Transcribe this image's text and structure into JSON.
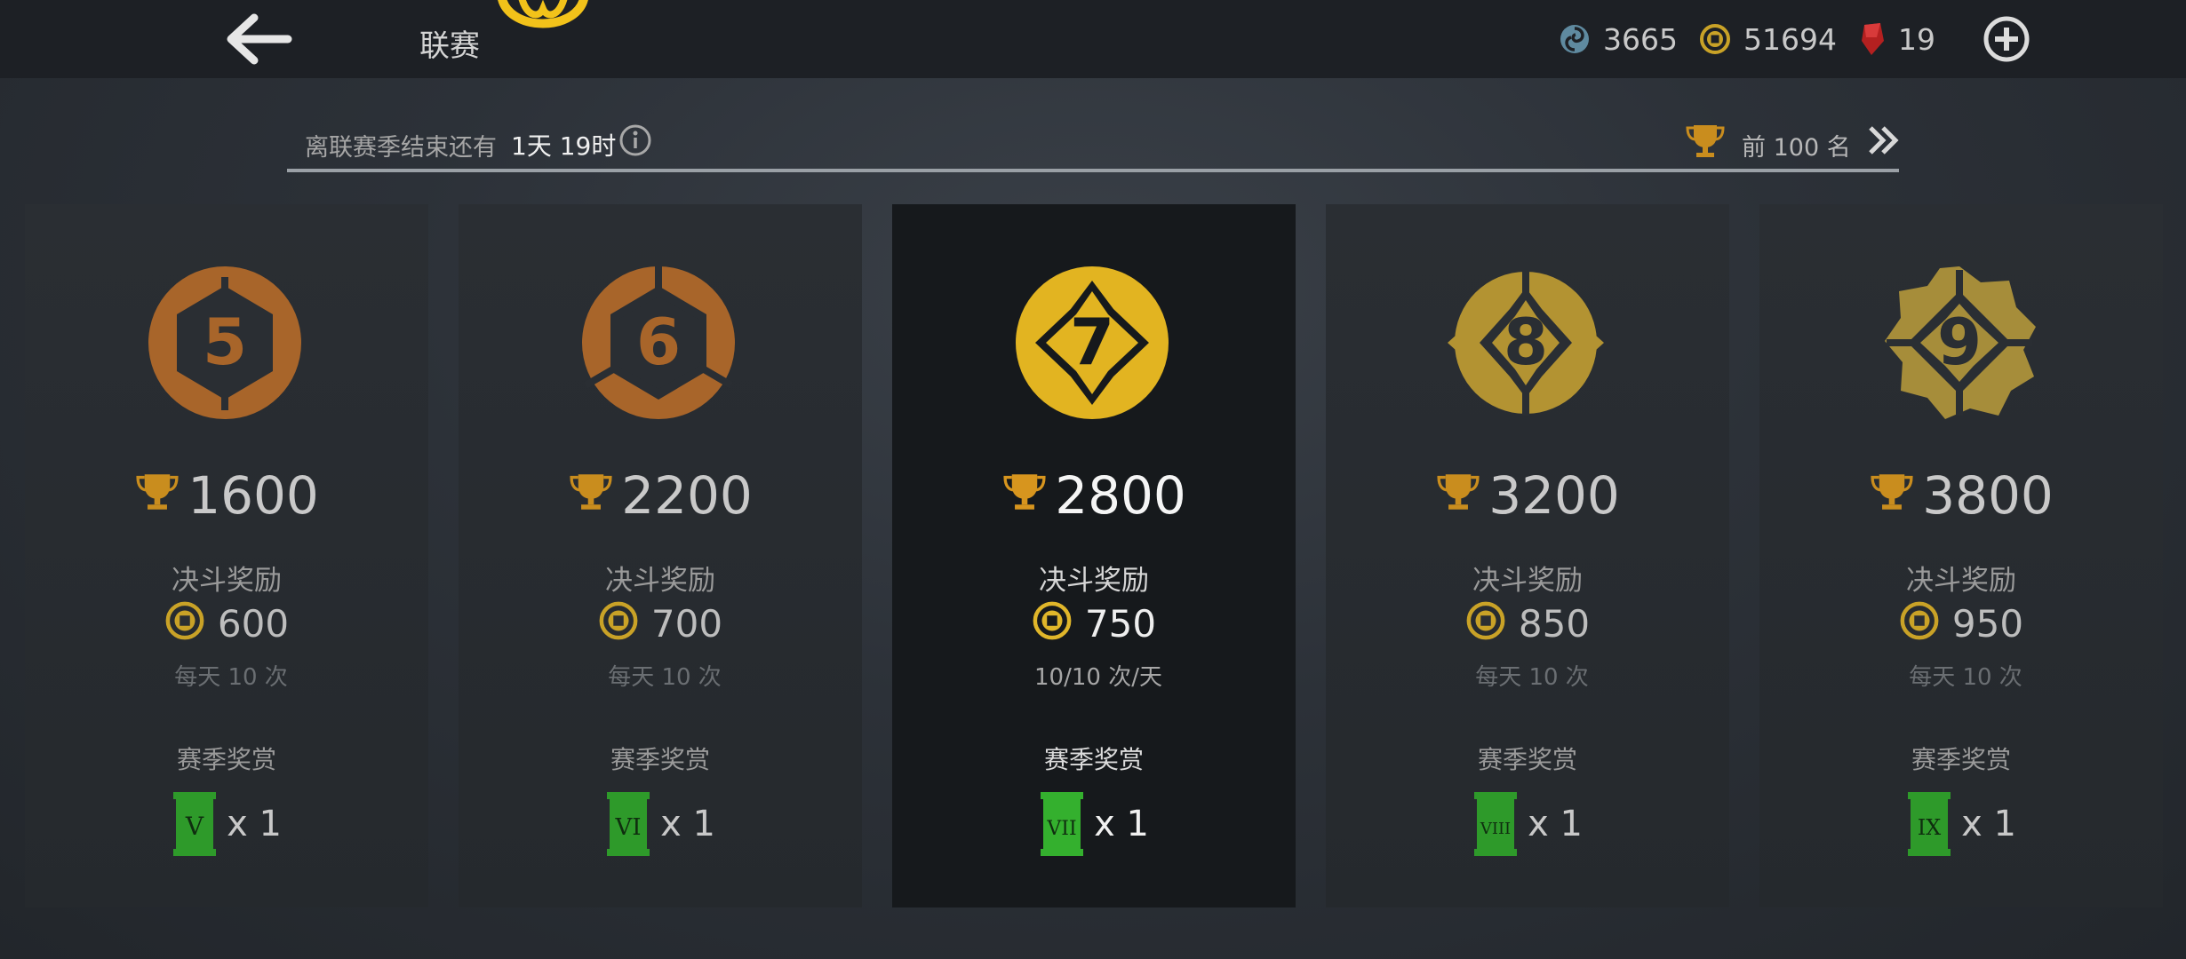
{
  "header": {
    "title": "联赛",
    "currencies": [
      {
        "icon": "spiral-token-icon",
        "value": "3665"
      },
      {
        "icon": "coin-icon",
        "value": "51694"
      },
      {
        "icon": "red-gem-icon",
        "value": "19"
      }
    ]
  },
  "season": {
    "ends_label": "离联赛季结束还有",
    "time_left": "1天 19时",
    "rank_label": "前 100 名"
  },
  "colors": {
    "gold": "#c98d1e",
    "chest_green": "#2e9a2a",
    "bronze": "#a8652a"
  },
  "cards": [
    {
      "badge": "5",
      "trophies": "1600",
      "duel_label": "决斗奖励",
      "coins": "600",
      "daily": "每天 10 次",
      "season_label": "赛季奖赏",
      "chest_tier": "V",
      "chest_qty": "x 1",
      "tier": "bronze"
    },
    {
      "badge": "6",
      "trophies": "2200",
      "duel_label": "决斗奖励",
      "coins": "700",
      "daily": "每天 10 次",
      "season_label": "赛季奖赏",
      "chest_tier": "VI",
      "chest_qty": "x 1",
      "tier": "bronze"
    },
    {
      "badge": "7",
      "trophies": "2800",
      "duel_label": "决斗奖励",
      "coins": "750",
      "daily": "10/10 次/天",
      "season_label": "赛季奖赏",
      "chest_tier": "VII",
      "chest_qty": "x 1",
      "tier": "gold",
      "selected": true
    },
    {
      "badge": "8",
      "trophies": "3200",
      "duel_label": "决斗奖励",
      "coins": "850",
      "daily": "每天 10 次",
      "season_label": "赛季奖赏",
      "chest_tier": "VIII",
      "chest_qty": "x 1",
      "tier": "gold-dim"
    },
    {
      "badge": "9",
      "trophies": "3800",
      "duel_label": "决斗奖励",
      "coins": "950",
      "daily": "每天 10 次",
      "season_label": "赛季奖赏",
      "chest_tier": "IX",
      "chest_qty": "x 1",
      "tier": "gold-dim"
    }
  ]
}
